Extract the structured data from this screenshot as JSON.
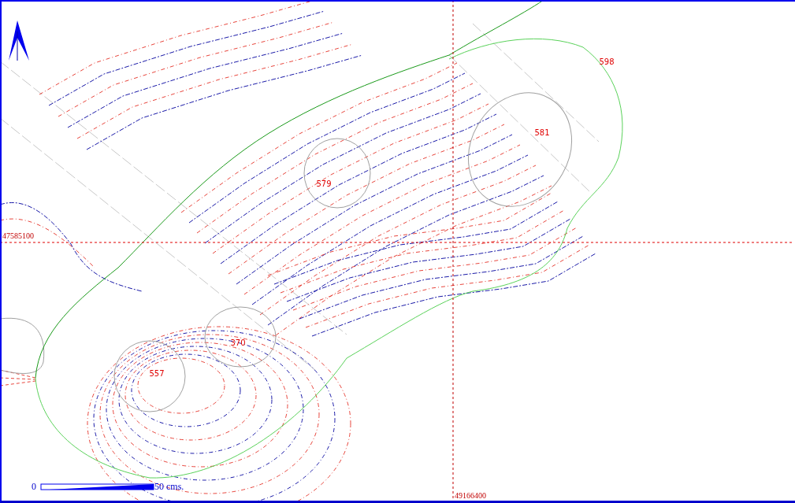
{
  "point_labels": [
    {
      "text": "598"
    },
    {
      "text": "581"
    },
    {
      "text": "579"
    },
    {
      "text": "370"
    },
    {
      "text": "557"
    }
  ],
  "grid": {
    "y_label": "47585100",
    "x_label": "49166400"
  },
  "scale_bar": {
    "start": "0",
    "end": "50 cms."
  }
}
